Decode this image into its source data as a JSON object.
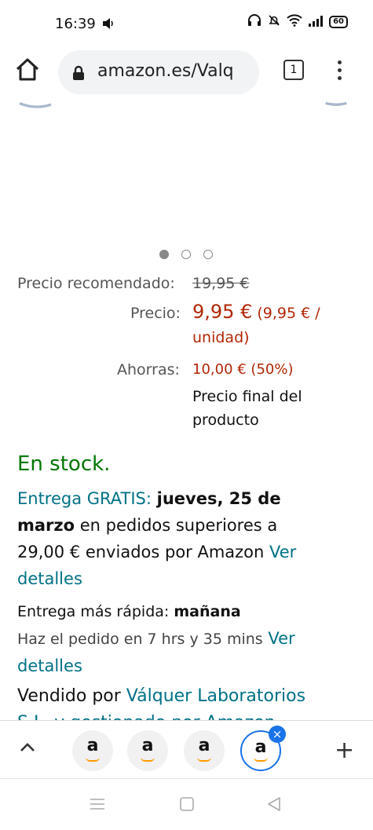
{
  "status": {
    "time": "16:39",
    "battery": "60"
  },
  "browser": {
    "url": "amazon.es/Valq",
    "tab_count": "1"
  },
  "carousel": {
    "dots": 3,
    "active_index": 0
  },
  "pricing": {
    "list_label": "Precio recomendado:",
    "list_price": "19,95 €",
    "price_label": "Precio:",
    "price_main": "9,95 €",
    "price_unit_1": "(9,95 € /",
    "price_unit_2": "unidad)",
    "save_label": "Ahorras:",
    "save_value": "10,00 € (50%)",
    "final_1": "Precio final del",
    "final_2": "producto"
  },
  "stock": "En stock.",
  "delivery": {
    "free_label": "Entrega GRATIS:",
    "date_1": "jueves, 25 de",
    "date_2": "marzo",
    "text_1": "en pedidos superiores a",
    "text_2": "29,00 € enviados por Amazon",
    "link_1": "Ver",
    "link_2": "detalles"
  },
  "fast": {
    "label": "Entrega más rápida:",
    "day": "mañana",
    "order_text": "Haz el pedido en 7 hrs y 35 mins",
    "link_1": "Ver",
    "link_2": "detalles"
  },
  "seller": {
    "label": "Vendido por",
    "name": "Válquer Laboratorios",
    "cut_text": "S.L. y gestionado por Amazon"
  },
  "tabs": {
    "icon_letter": "a",
    "close": "×",
    "add": "+"
  }
}
